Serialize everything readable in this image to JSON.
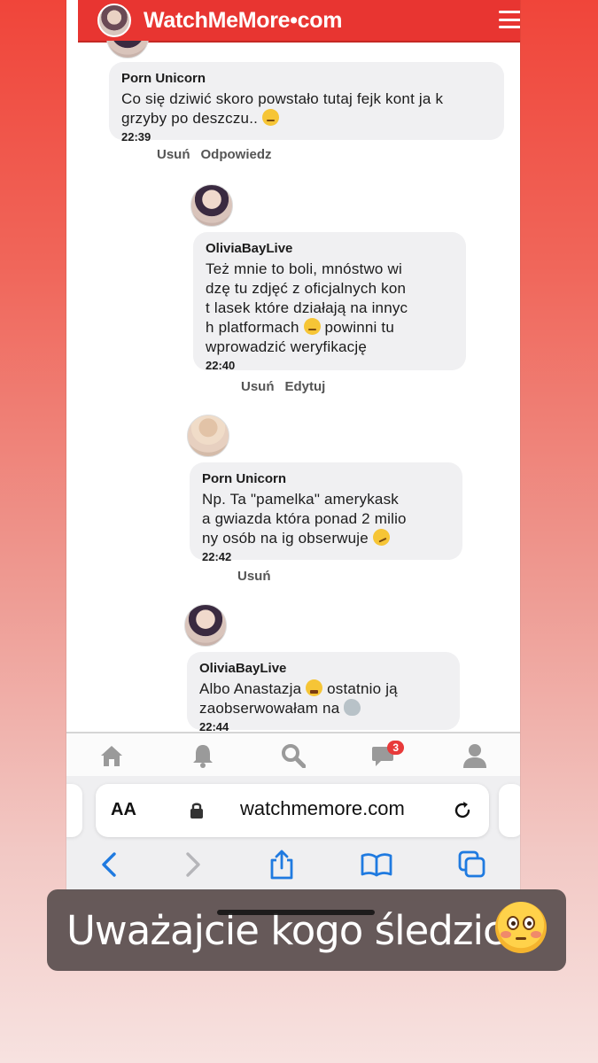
{
  "site": {
    "logo_text": "WatchMeMore•com",
    "menu_icon": "hamburger-icon"
  },
  "comments": [
    {
      "author": "Porn Unicorn",
      "text": "Co się dziwić skoro powstało tutaj fejk kont ja k grzyby po deszczu.. ",
      "time": "22:39",
      "actions": [
        "Usuń",
        "Odpowiedz"
      ]
    },
    {
      "author": "OliviaBayLive",
      "text_lines": [
        "Też mnie to boli, mnóstwo wi",
        "dzę tu zdjęć z oficjalnych kon",
        "t lasek które działają na innyc",
        "h platformach ",
        "wprowadzić weryfikację"
      ],
      "text_after_emoji": " powinni tu",
      "time": "22:40",
      "actions": [
        "Usuń",
        "Edytuj"
      ]
    },
    {
      "author": "Porn Unicorn",
      "text_lines": [
        "Np. Ta \"pamelka\" amerykask",
        "a gwiazda która ponad 2 milio",
        "ny osób na ig obserwuje "
      ],
      "time": "22:42",
      "actions": [
        "Usuń"
      ]
    },
    {
      "author": "OliviaBayLive",
      "text_lines": [
        "Albo Anastazja ",
        "zaobserwowałam na "
      ],
      "text_after_emoji": " ostatnio ją",
      "time": "22:44"
    }
  ],
  "site_nav": {
    "icons": [
      "home-icon",
      "bell-icon",
      "search-icon",
      "messages-icon",
      "profile-icon"
    ],
    "messages_badge": "3"
  },
  "browser": {
    "aa_label": "AA",
    "url": "watchmemore.com",
    "toolbar_icons": [
      "back-icon",
      "forward-icon",
      "share-icon",
      "bookmarks-icon",
      "tabs-icon"
    ]
  },
  "caption": {
    "text": "Uważajcie kogo śledzicie"
  }
}
